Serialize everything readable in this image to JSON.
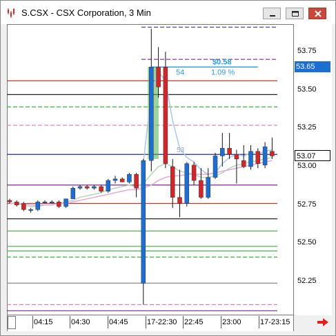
{
  "window": {
    "title": "S.CSX - CSX Corporation, 3 Min",
    "minimize_icon": "minimize-icon",
    "maximize_icon": "maximize-icon",
    "close_icon": "close-icon"
  },
  "y_axis": {
    "ticks": [
      "53.75",
      "53.50",
      "53.25",
      "53.00",
      "52.75",
      "52.50",
      "52.25"
    ],
    "tick_values": [
      53.75,
      53.5,
      53.25,
      53.0,
      52.75,
      52.5,
      52.25
    ],
    "current_price_label": "53.65",
    "current_price": 53.65,
    "last_price_label": "53.07",
    "last_price": 53.07
  },
  "x_axis": {
    "ticks": [
      "04:15",
      "04:30",
      "04:45",
      "17-22:30",
      "22:45",
      "23:00",
      "17-23:15"
    ]
  },
  "measure": {
    "change_label": "$0.58",
    "bars_label": "54",
    "percent_label": "1.09 %",
    "start_bars_label": "53"
  },
  "colors": {
    "up": "#1c6fd1",
    "down": "#d2262b",
    "price_box": "#1c6fd1",
    "last_box": "#ffffff",
    "measure": "#2a9be2"
  },
  "chart_data": {
    "type": "candlestick",
    "title": "",
    "ylim": [
      52.03,
      53.93
    ],
    "horizontal_levels": [
      {
        "value": 53.91,
        "color": "#3a3aa0",
        "style": "dashed"
      },
      {
        "value": 53.7,
        "color": "#7a2a8a",
        "style": "dashed"
      },
      {
        "value": 53.56,
        "color": "#c0392b",
        "style": "solid"
      },
      {
        "value": 53.47,
        "color": "#222222",
        "style": "solid"
      },
      {
        "value": 53.39,
        "color": "#3cb043",
        "style": "dashed"
      },
      {
        "value": 53.27,
        "color": "#d87ab8",
        "style": "dashed"
      },
      {
        "value": 53.08,
        "color": "#1f2aa8",
        "style": "solid"
      },
      {
        "value": 52.88,
        "color": "#7a2a8a",
        "style": "solid"
      },
      {
        "value": 52.76,
        "color": "#c0392b",
        "style": "solid"
      },
      {
        "value": 52.66,
        "color": "#222222",
        "style": "solid"
      },
      {
        "value": 52.58,
        "color": "#3cb043",
        "style": "solid"
      },
      {
        "value": 52.48,
        "color": "#3cb043",
        "style": "solid"
      },
      {
        "value": 52.45,
        "color": "#3cb043",
        "style": "solid"
      },
      {
        "value": 52.41,
        "color": "#3cb043",
        "style": "dashed"
      },
      {
        "value": 52.24,
        "color": "#888888",
        "style": "solid"
      },
      {
        "value": 52.1,
        "color": "#d87ab8",
        "style": "dashed"
      },
      {
        "value": 52.06,
        "color": "#7a2a8a",
        "style": "solid"
      }
    ],
    "candles": [
      {
        "o": 52.78,
        "h": 52.79,
        "l": 52.76,
        "c": 52.77
      },
      {
        "o": 52.77,
        "h": 52.78,
        "l": 52.74,
        "c": 52.75
      },
      {
        "o": 52.76,
        "h": 52.77,
        "l": 52.71,
        "c": 52.72
      },
      {
        "o": 52.72,
        "h": 52.73,
        "l": 52.7,
        "c": 52.72
      },
      {
        "o": 52.72,
        "h": 52.78,
        "l": 52.71,
        "c": 52.77
      },
      {
        "o": 52.77,
        "h": 52.78,
        "l": 52.76,
        "c": 52.77
      },
      {
        "o": 52.77,
        "h": 52.78,
        "l": 52.76,
        "c": 52.77
      },
      {
        "o": 52.77,
        "h": 52.78,
        "l": 52.73,
        "c": 52.74
      },
      {
        "o": 52.74,
        "h": 52.79,
        "l": 52.73,
        "c": 52.79
      },
      {
        "o": 52.79,
        "h": 52.87,
        "l": 52.79,
        "c": 52.86
      },
      {
        "o": 52.86,
        "h": 52.88,
        "l": 52.85,
        "c": 52.87
      },
      {
        "o": 52.87,
        "h": 52.88,
        "l": 52.85,
        "c": 52.86
      },
      {
        "o": 52.86,
        "h": 52.88,
        "l": 52.85,
        "c": 52.87
      },
      {
        "o": 52.87,
        "h": 52.88,
        "l": 52.83,
        "c": 52.84
      },
      {
        "o": 52.84,
        "h": 52.92,
        "l": 52.83,
        "c": 52.91
      },
      {
        "o": 52.91,
        "h": 52.94,
        "l": 52.89,
        "c": 52.92
      },
      {
        "o": 52.92,
        "h": 52.93,
        "l": 52.9,
        "c": 52.9
      },
      {
        "o": 52.9,
        "h": 52.96,
        "l": 52.89,
        "c": 52.95
      },
      {
        "o": 52.95,
        "h": 52.96,
        "l": 52.8,
        "c": 52.86
      },
      {
        "o": 52.24,
        "h": 53.05,
        "l": 52.1,
        "c": 53.04
      },
      {
        "o": 53.04,
        "h": 53.9,
        "l": 52.97,
        "c": 53.65
      },
      {
        "o": 53.65,
        "h": 53.78,
        "l": 53.45,
        "c": 53.52
      },
      {
        "o": 53.65,
        "h": 53.75,
        "l": 52.99,
        "c": 53.02
      },
      {
        "o": 53.0,
        "h": 53.05,
        "l": 52.73,
        "c": 52.8
      },
      {
        "o": 52.8,
        "h": 52.98,
        "l": 52.67,
        "c": 52.76
      },
      {
        "o": 52.76,
        "h": 53.03,
        "l": 52.74,
        "c": 53.02
      },
      {
        "o": 53.01,
        "h": 53.03,
        "l": 52.88,
        "c": 52.91
      },
      {
        "o": 52.91,
        "h": 52.99,
        "l": 52.79,
        "c": 52.8
      },
      {
        "o": 52.8,
        "h": 52.99,
        "l": 52.79,
        "c": 52.93
      },
      {
        "o": 52.93,
        "h": 53.09,
        "l": 52.92,
        "c": 53.07
      },
      {
        "o": 53.07,
        "h": 53.22,
        "l": 53.0,
        "c": 53.12
      },
      {
        "o": 53.12,
        "h": 53.22,
        "l": 53.05,
        "c": 53.08
      },
      {
        "o": 53.08,
        "h": 53.11,
        "l": 52.89,
        "c": 53.05
      },
      {
        "o": 53.04,
        "h": 53.14,
        "l": 52.99,
        "c": 53.0
      },
      {
        "o": 53.0,
        "h": 53.14,
        "l": 52.98,
        "c": 53.1
      },
      {
        "o": 53.1,
        "h": 53.12,
        "l": 52.99,
        "c": 53.02
      },
      {
        "o": 53.01,
        "h": 53.16,
        "l": 52.99,
        "c": 53.13
      },
      {
        "o": 53.1,
        "h": 53.19,
        "l": 53.05,
        "c": 53.07
      }
    ],
    "ma_series": [
      {
        "name": "",
        "color": "#a9c8e6",
        "values": [
          null,
          null,
          null,
          null,
          null,
          null,
          null,
          null,
          null,
          null,
          null,
          null,
          null,
          null,
          null,
          null,
          null,
          null,
          null,
          53.03,
          53.48,
          53.62,
          53.56,
          53.3,
          53.12,
          53.06,
          53.03,
          52.98,
          52.95,
          52.96,
          53.02,
          53.06,
          53.08,
          53.07,
          53.09,
          53.08,
          53.1,
          53.11
        ]
      },
      {
        "name": "",
        "color": "#b7d6b7",
        "values": [
          52.76,
          52.76,
          52.75,
          52.74,
          52.74,
          52.75,
          52.75,
          52.76,
          52.77,
          52.78,
          52.8,
          52.81,
          52.82,
          52.83,
          52.85,
          52.86,
          52.87,
          52.88,
          52.87,
          52.89,
          52.95,
          53.0,
          53.02,
          53.0,
          52.97,
          52.96,
          52.95,
          52.93,
          52.93,
          52.94,
          52.96,
          52.99,
          53.01,
          53.02,
          53.03,
          53.04,
          53.05,
          53.06
        ]
      },
      {
        "name": "",
        "color": "#e6a9d6",
        "values": [
          52.76,
          52.76,
          52.76,
          52.75,
          52.75,
          52.75,
          52.75,
          52.76,
          52.76,
          52.77,
          52.78,
          52.79,
          52.8,
          52.81,
          52.82,
          52.83,
          52.84,
          52.85,
          52.85,
          52.86,
          52.88,
          52.91,
          52.93,
          52.94,
          52.94,
          52.95,
          52.95,
          52.95,
          52.95,
          52.96,
          52.97,
          52.98,
          52.99,
          53.0,
          53.01,
          53.02,
          53.03,
          53.04
        ]
      }
    ]
  }
}
